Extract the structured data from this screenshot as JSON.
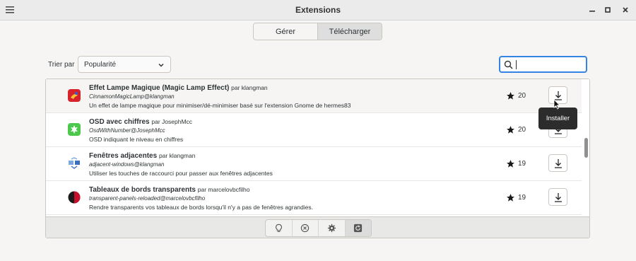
{
  "window": {
    "title": "Extensions"
  },
  "tabs": [
    {
      "label": "Gérer",
      "active": false
    },
    {
      "label": "Télécharger",
      "active": true
    }
  ],
  "sort": {
    "label": "Trier par",
    "selected": "Popularité"
  },
  "search": {
    "value": ""
  },
  "extensions": [
    {
      "name": "Effet Lampe Magique (Magic Lamp Effect)",
      "author": "par klangman",
      "uuid": "CinnamonMagicLamp@klangman",
      "description": "Un effet de lampe magique pour minimiser/dé-minimiser basé sur l'extension Gnome de hermes83",
      "rating": "20",
      "icon": "magic-lamp-icon"
    },
    {
      "name": "OSD avec chiffres",
      "author": "par JosephMcc",
      "uuid": "OsdWithNumber@JosephMcc",
      "description": "OSD indiquant le niveau en chiffres",
      "rating": "20",
      "icon": "osd-number-icon"
    },
    {
      "name": "Fenêtres adjacentes",
      "author": "par klangman",
      "uuid": "adjacent-windows@klangman",
      "description": "Utiliser les touches de raccourci pour passer aux fenêtres adjacentes",
      "rating": "19",
      "icon": "adjacent-windows-icon"
    },
    {
      "name": "Tableaux de bords transparents",
      "author": "par marcelovbcfilho",
      "uuid": "transparent-panels-reloaded@marcelovbcfilho",
      "description": "Rendre transparents vos tableaux de bords lorsqu'il n'y a pas de fenêtres agrandies.",
      "rating": "19",
      "icon": "transparent-panels-icon"
    }
  ],
  "tooltip": {
    "text": "Installer"
  },
  "colors": {
    "accent": "#3584e4",
    "tooltip_bg": "#2c2c2c",
    "window_bg": "#f6f5f4"
  }
}
